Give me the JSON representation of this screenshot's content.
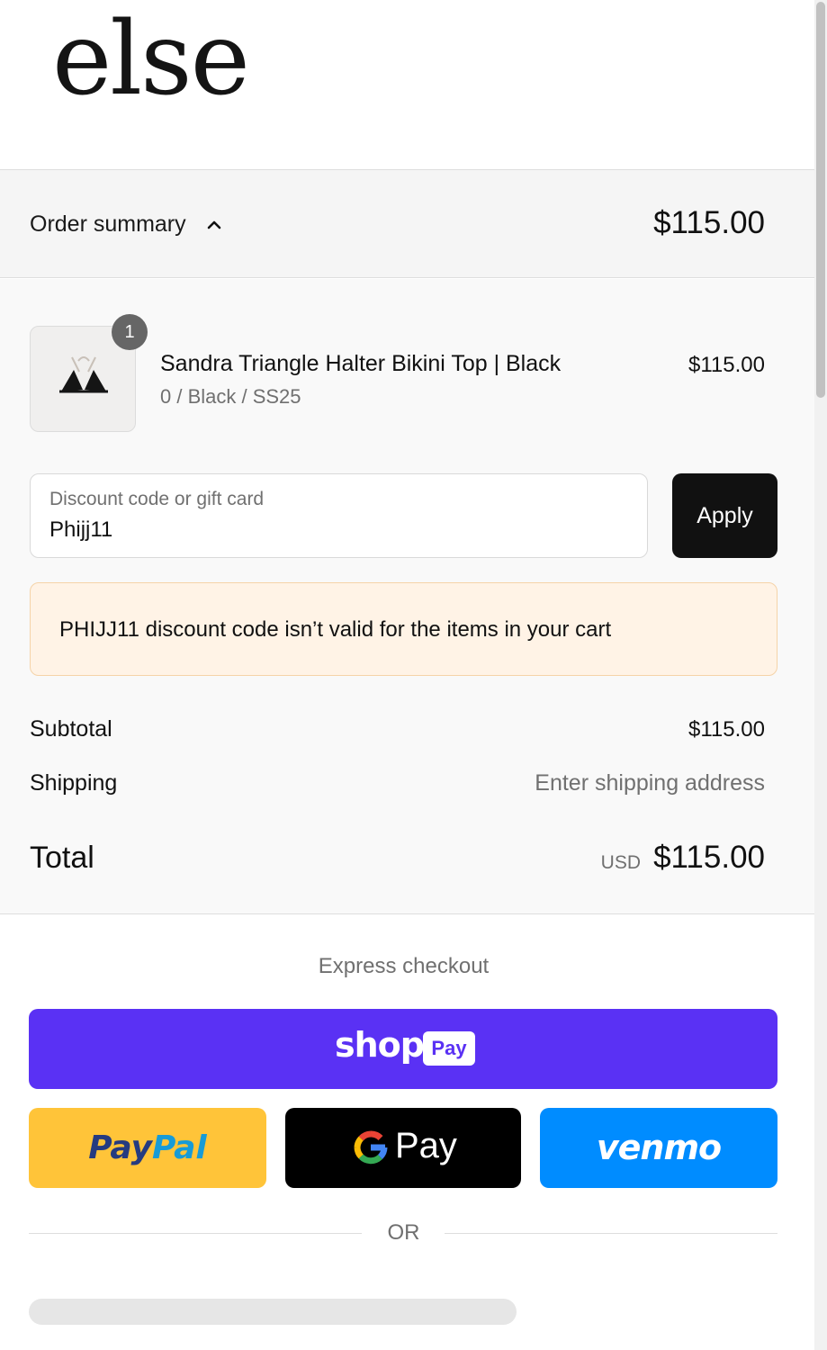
{
  "brand": {
    "logo_text": "else"
  },
  "order_summary": {
    "toggle_label": "Order summary",
    "total": "$115.00"
  },
  "item": {
    "quantity": "1",
    "name": "Sandra Triangle Halter Bikini Top | Black",
    "variant": "0 / Black / SS25",
    "price": "$115.00"
  },
  "discount": {
    "label": "Discount code or gift card",
    "value": "Phijj11",
    "apply_label": "Apply",
    "error_message": "PHIJJ11 discount code isn’t valid for the items in your cart"
  },
  "totals": {
    "subtotal_label": "Subtotal",
    "subtotal_value": "$115.00",
    "shipping_label": "Shipping",
    "shipping_value": "Enter shipping address",
    "total_label": "Total",
    "currency": "USD",
    "total_value": "$115.00"
  },
  "express_checkout": {
    "title": "Express checkout",
    "shop_pay": {
      "word": "shop",
      "tag": "Pay"
    },
    "paypal": {
      "part1": "Pay",
      "part2": "Pal"
    },
    "gpay": {
      "text": "Pay"
    },
    "venmo": {
      "text": "venmo"
    },
    "divider_text": "OR"
  },
  "colors": {
    "shop_pay": "#5a31f4",
    "paypal": "#ffc439",
    "venmo": "#008cff",
    "error_bg": "#fff3e6"
  },
  "icons": {
    "chevron": "chevron-up-icon",
    "google": "google-g-icon"
  }
}
